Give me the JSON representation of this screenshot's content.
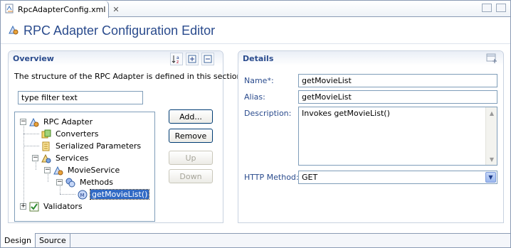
{
  "tab": {
    "label": "RpcAdapterConfig.xml",
    "close": "✕"
  },
  "editor": {
    "title": "RPC Adapter Configuration Editor"
  },
  "overview": {
    "title": "Overview",
    "description": "The structure of the RPC Adapter is defined in this section.",
    "filter_placeholder": "type filter text",
    "tree": [
      {
        "label": "RPC Adapter",
        "icon": "rpc-adapter-icon"
      },
      {
        "label": "Converters",
        "icon": "converters-icon"
      },
      {
        "label": "Serialized Parameters",
        "icon": "serialized-parameters-icon"
      },
      {
        "label": "Services",
        "icon": "services-icon"
      },
      {
        "label": "MovieService",
        "icon": "service-icon"
      },
      {
        "label": "Methods",
        "icon": "methods-icon"
      },
      {
        "label": "getMovieList()",
        "icon": "method-icon"
      },
      {
        "label": "Validators",
        "icon": "validators-icon"
      }
    ],
    "buttons": {
      "add": "Add...",
      "remove": "Remove",
      "up": "Up",
      "down": "Down"
    }
  },
  "details": {
    "title": "Details",
    "name_label": "Name*:",
    "name_value": "getMovieList",
    "alias_label": "Alias:",
    "alias_value": "getMovieList",
    "description_label": "Description:",
    "description_value": "Invokes getMovieList()",
    "http_method_label": "HTTP Method:",
    "http_method_value": "GET"
  },
  "bottom_tabs": [
    "Design",
    "Source"
  ],
  "colors": {
    "title_blue": "#2a4b8d",
    "selection": "#316ac5"
  }
}
